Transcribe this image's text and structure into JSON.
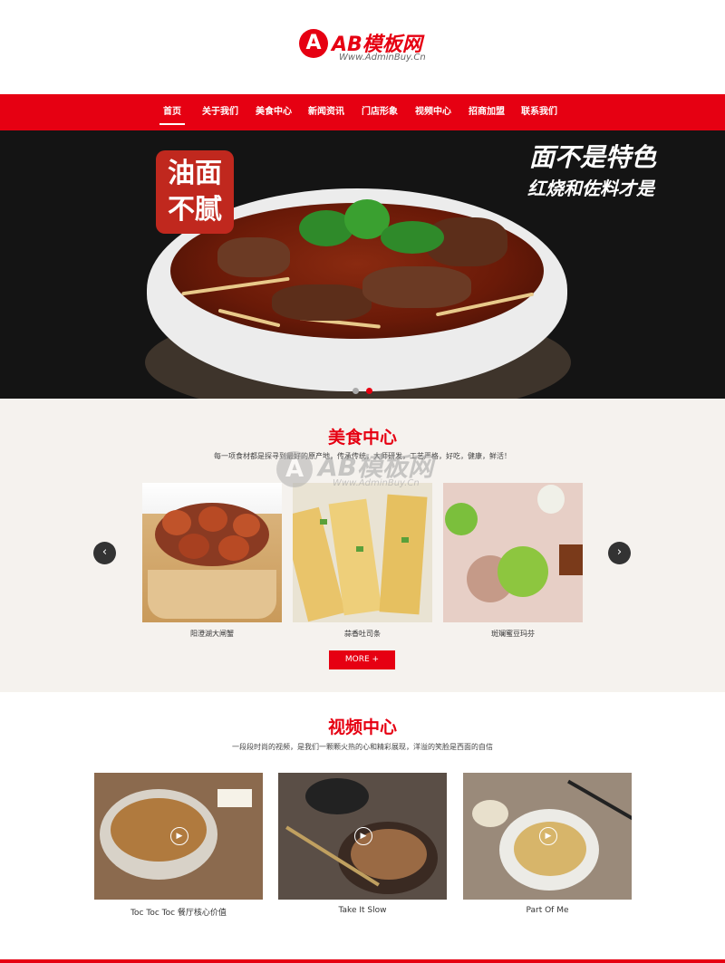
{
  "logo": {
    "mark": "A",
    "text": "AB模板网",
    "sub": "Www.AdminBuy.Cn"
  },
  "nav": {
    "items": [
      "首页",
      "关于我们",
      "美食中心",
      "新闻资讯",
      "门店形象",
      "视频中心",
      "招商加盟",
      "联系我们"
    ],
    "active": 0
  },
  "banner": {
    "badge_line1": "油面",
    "badge_line2": "不腻",
    "slogan_line1": "面不是特色",
    "slogan_line2": "红烧和佐料才是"
  },
  "food": {
    "title": "美食中心",
    "desc": "每一项食材都是探寻到最好的原产地，传承传统，大师研发，工艺严格，好吃，健康，鲜活！",
    "prev_icon": "chevron-left-icon",
    "next_icon": "chevron-right-icon",
    "prev": "‹",
    "next": "›",
    "items": [
      {
        "caption": "阳澄湖大闸蟹"
      },
      {
        "caption": "蒜香吐司条"
      },
      {
        "caption": "斑斓蜜豆玛芬"
      }
    ],
    "more": "MORE +"
  },
  "watermark": {
    "mark": "A",
    "text": "AB模板网",
    "sub": "Www.AdminBuy.Cn"
  },
  "video": {
    "title": "视频中心",
    "desc": "一段段时尚的视频，是我们一颗颗火热的心和精彩展现，洋溢的笑脸是西面的自信",
    "play_icon": "play-icon",
    "play": "▶",
    "items": [
      {
        "caption": "Toc Toc Toc 餐厅核心价值"
      },
      {
        "caption": "Take It Slow"
      },
      {
        "caption": "Part Of Me"
      }
    ]
  },
  "colors": {
    "brand": "#e60012",
    "dark": "#141414",
    "section_bg": "#f5f2ee"
  }
}
